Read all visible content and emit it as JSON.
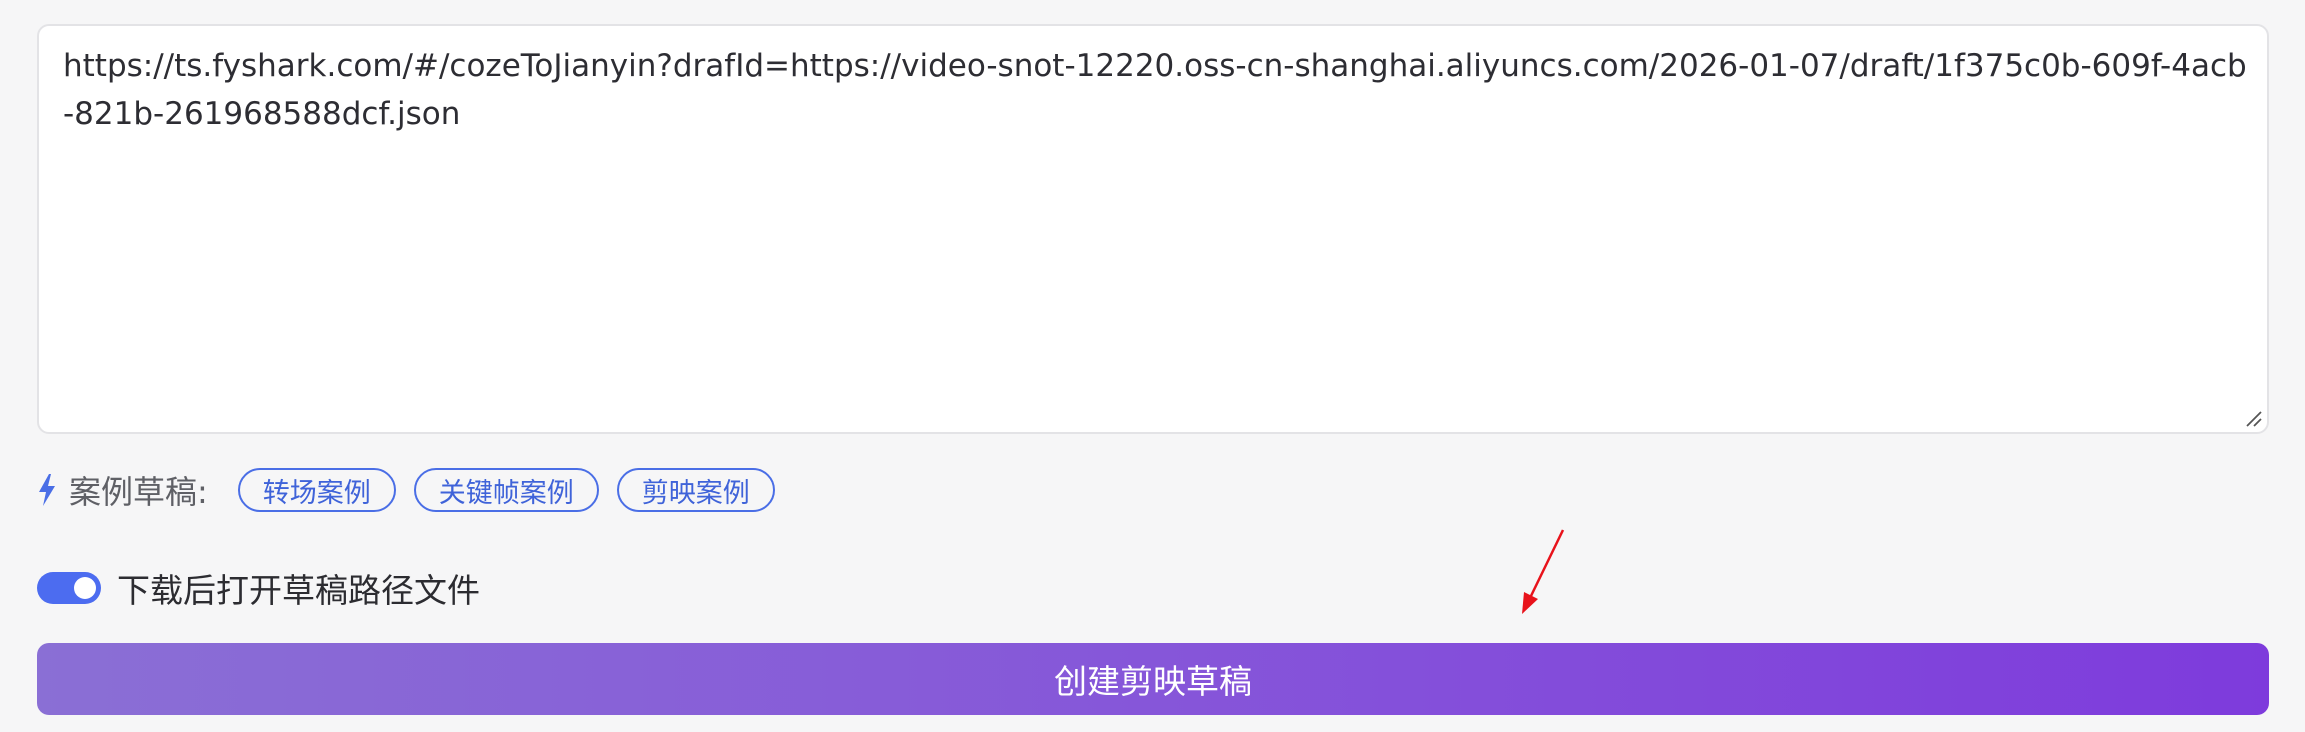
{
  "draft_input": {
    "value": "https://ts.fyshark.com/#/cozeToJianyin?drafId=https://video-snot-12220.oss-cn-shanghai.aliyuncs.com/2026-01-07/draft/1f375c0b-609f-4acb-821b-261968588dcf.json"
  },
  "examples": {
    "icon": "lightning-bolt-icon",
    "label": "案例草稿:",
    "items": [
      {
        "label": "转场案例"
      },
      {
        "label": "关键帧案例"
      },
      {
        "label": "剪映案例"
      }
    ]
  },
  "open_path_option": {
    "label": "下载后打开草稿路径文件",
    "enabled": true
  },
  "create_button": {
    "label": "创建剪映草稿"
  },
  "colors": {
    "accent": "#4c6cf0",
    "chip_border": "#4a6ee6",
    "button_gradient_start": "#8a6fd5",
    "button_gradient_end": "#7e3bdc",
    "annotation_arrow": "#e8121b"
  }
}
